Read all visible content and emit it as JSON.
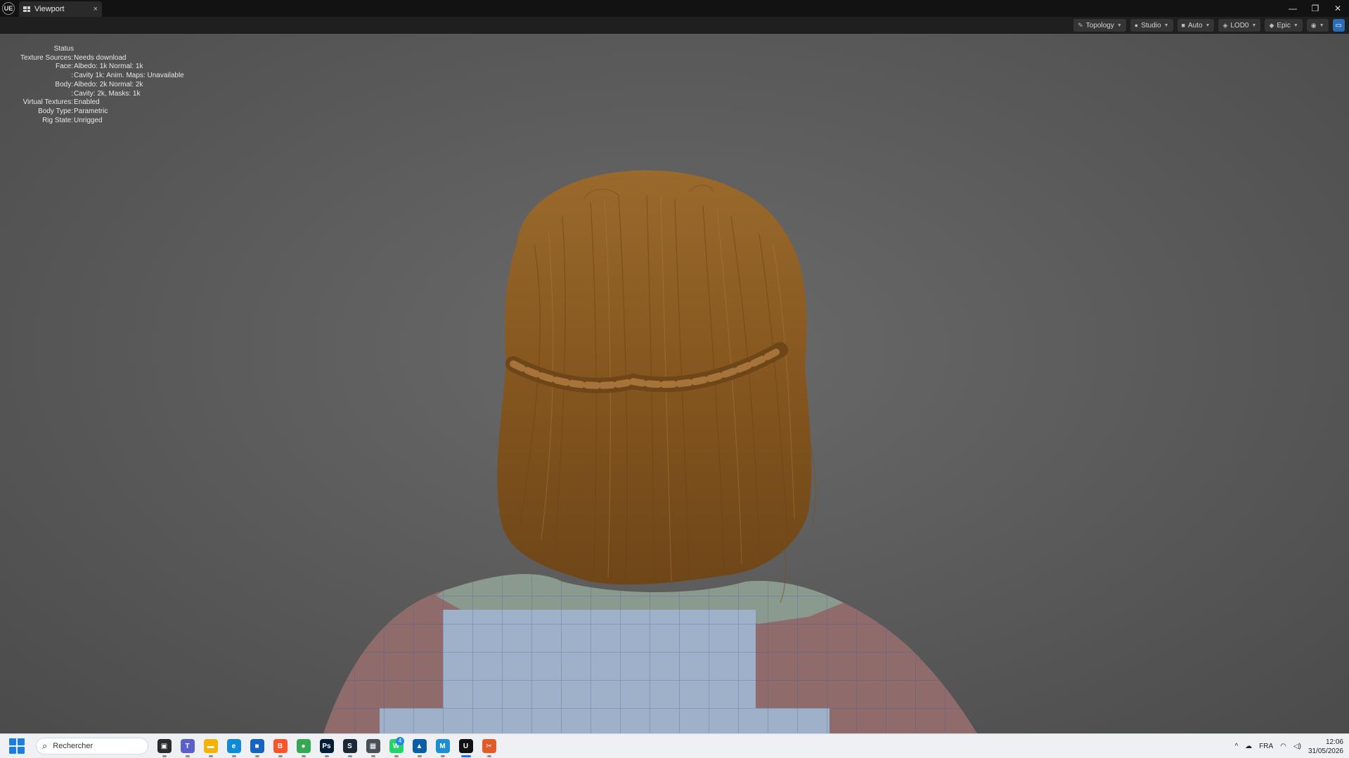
{
  "window": {
    "app_logo": "UE",
    "tab_label": "Viewport",
    "tab_close": "×",
    "controls": {
      "minimize": "—",
      "restore": "❐",
      "close": "✕"
    }
  },
  "toolbar": {
    "topology": "Topology",
    "studio": "Studio",
    "auto": "Auto",
    "lod": "LOD0",
    "epic": "Epic"
  },
  "status": {
    "title": "Status",
    "rows": [
      {
        "key": "Texture Sources:",
        "value": "Needs download"
      },
      {
        "key": "Face:",
        "value": "Albedo: 1k Normal: 1k"
      },
      {
        "key": ":",
        "value": "Cavity 1k: Anim. Maps: Unavailable"
      },
      {
        "key": "Body:",
        "value": "Albedo: 2k Normal: 2k"
      },
      {
        "key": ":",
        "value": "Cavity: 2k, Masks: 1k"
      },
      {
        "key": "Virtual Textures:",
        "value": "Enabled"
      },
      {
        "key": "Body Type:",
        "value": "Parametric"
      },
      {
        "key": "Rig State:",
        "value": "Unrigged"
      }
    ]
  },
  "taskbar": {
    "search_placeholder": "Rechercher",
    "apps": [
      {
        "name": "task-view",
        "glyph": "▣",
        "color": "#2b2b2b"
      },
      {
        "name": "teams",
        "glyph": "T",
        "color": "#5b5fc7"
      },
      {
        "name": "file-explorer",
        "glyph": "▬",
        "color": "#f2b400"
      },
      {
        "name": "edge",
        "glyph": "e",
        "color": "#0f8ad6"
      },
      {
        "name": "store",
        "glyph": "■",
        "color": "#1565c0"
      },
      {
        "name": "brave",
        "glyph": "B",
        "color": "#fb542b"
      },
      {
        "name": "chrome",
        "glyph": "●",
        "color": "#34a853"
      },
      {
        "name": "photoshop",
        "glyph": "Ps",
        "color": "#001e36"
      },
      {
        "name": "steam",
        "glyph": "S",
        "color": "#1b2838"
      },
      {
        "name": "calculator",
        "glyph": "▦",
        "color": "#4a4f57"
      },
      {
        "name": "whatsapp",
        "glyph": "W",
        "color": "#25d366",
        "badge": "4"
      },
      {
        "name": "photos",
        "glyph": "▲",
        "color": "#0a5ea8"
      },
      {
        "name": "metahuman",
        "glyph": "M",
        "color": "#1c8fd1"
      },
      {
        "name": "unreal-engine",
        "glyph": "U",
        "color": "#111111",
        "active": true
      },
      {
        "name": "snipping-tool",
        "glyph": "✂",
        "color": "#e05a2a"
      }
    ],
    "tray": {
      "chevron": "^",
      "lang": "FRA",
      "time": "12:06",
      "date": "31/05/2026"
    }
  },
  "colors": {
    "hair": "#8a5a22",
    "hair_dark": "#5e3a14",
    "mesh_blue": "#9fb1c8",
    "mesh_pink": "#8f6b6b",
    "mesh_green": "#8a9a8e",
    "accent": "#2a6db4"
  }
}
